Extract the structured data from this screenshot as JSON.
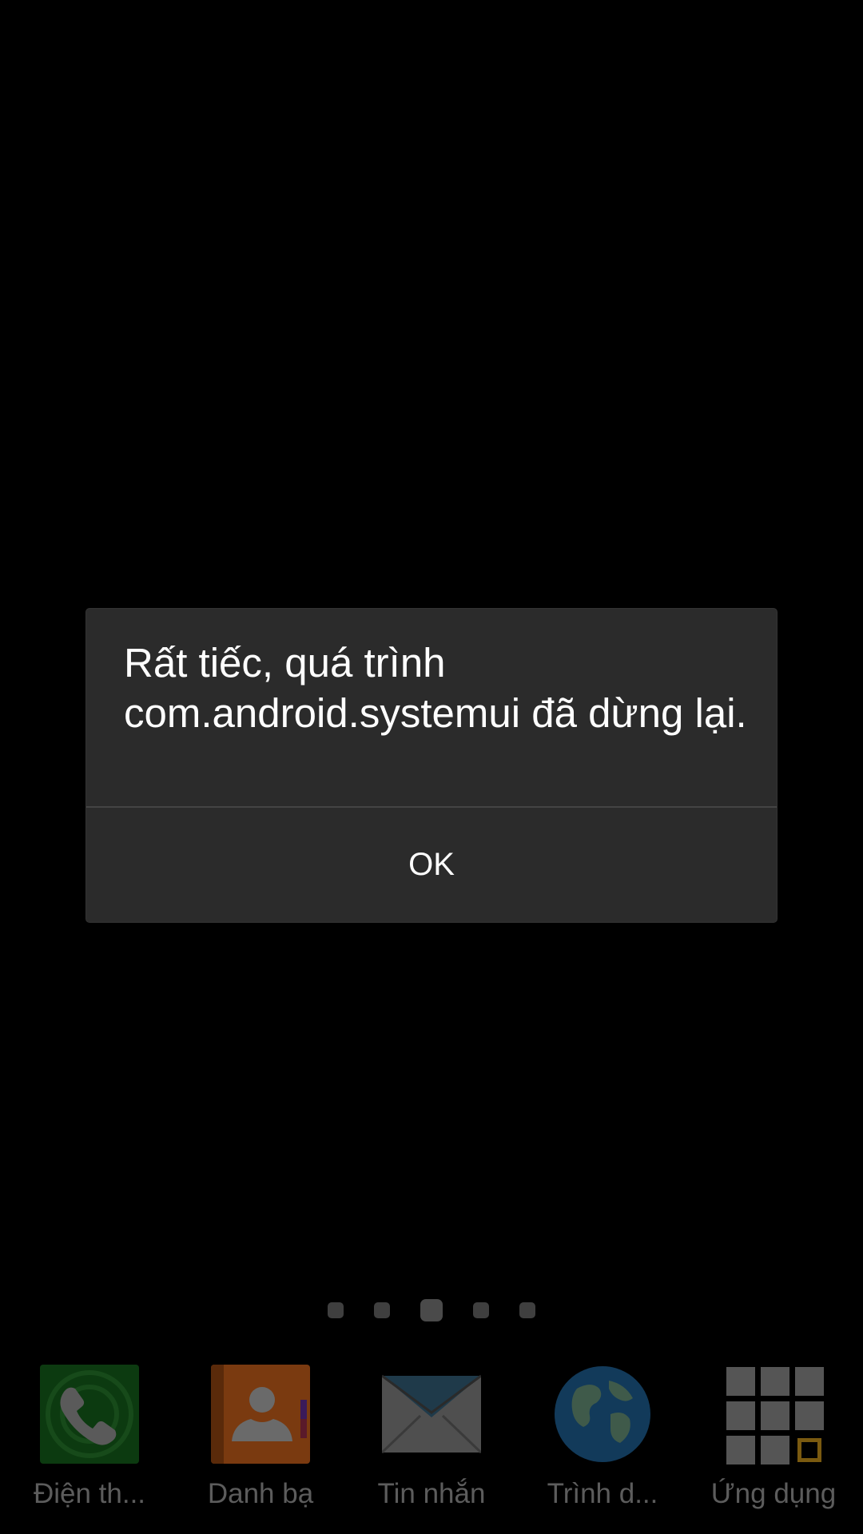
{
  "dialog": {
    "message": "Rất tiếc, quá trình com.android.systemui đã dừng lại.",
    "ok_label": "OK"
  },
  "home": {
    "page_indicator": {
      "pages": 5,
      "active_page": 3
    },
    "dock": [
      {
        "label": "Điện th...",
        "icon": "phone-icon"
      },
      {
        "label": "Danh bạ",
        "icon": "contacts-icon"
      },
      {
        "label": "Tin nhắn",
        "icon": "messages-icon"
      },
      {
        "label": "Trình d...",
        "icon": "browser-icon"
      },
      {
        "label": "Ứng dụng",
        "icon": "apps-icon"
      }
    ]
  },
  "colors": {
    "background": "#000000",
    "dialog_background": "#2b2b2b",
    "dialog_text": "#ffffff",
    "dock_label": "#5c5c5c"
  }
}
